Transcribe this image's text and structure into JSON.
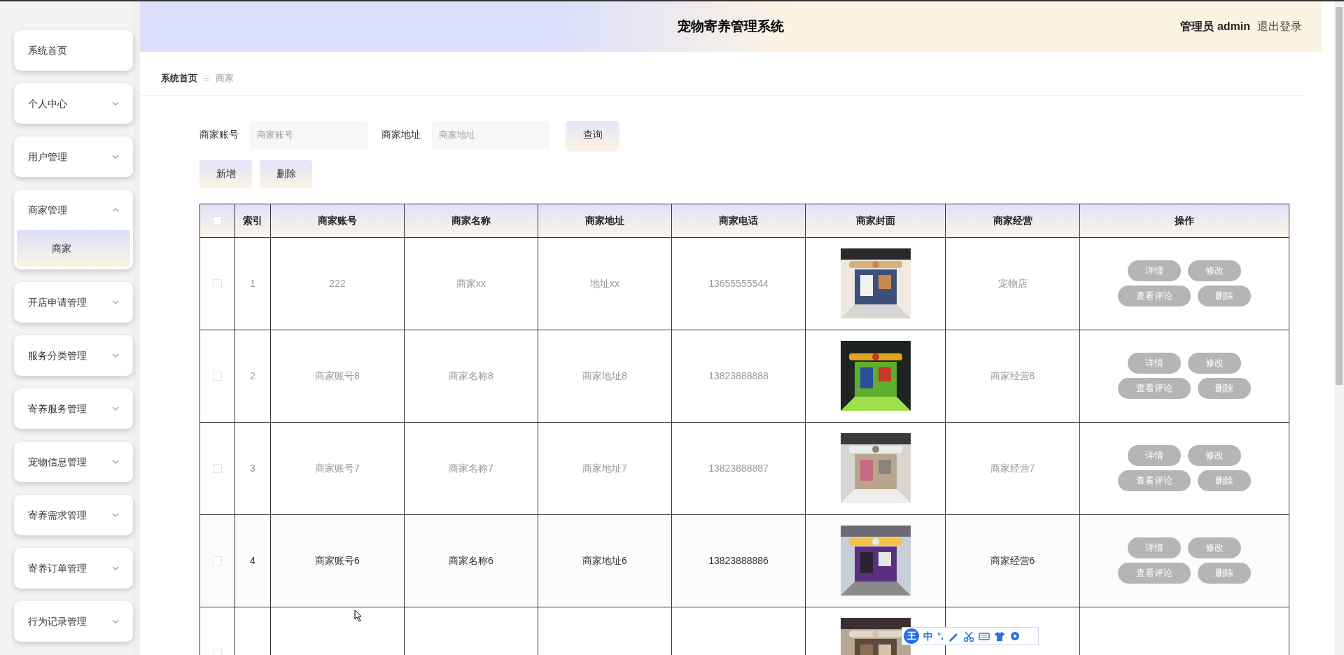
{
  "header": {
    "title": "宠物寄养管理系统",
    "user_role": "管理员",
    "user_name": "admin",
    "logout": "退出登录"
  },
  "sidebar": {
    "items": [
      {
        "label": "系统首页"
      },
      {
        "label": "个人中心",
        "expandable": true,
        "expanded": false
      },
      {
        "label": "用户管理",
        "expandable": true,
        "expanded": false
      },
      {
        "label": "商家管理",
        "expandable": true,
        "expanded": true,
        "children": [
          {
            "label": "商家",
            "selected": true
          }
        ]
      },
      {
        "label": "开店申请管理",
        "expandable": true,
        "expanded": false
      },
      {
        "label": "服务分类管理",
        "expandable": true,
        "expanded": false
      },
      {
        "label": "寄养服务管理",
        "expandable": true,
        "expanded": false
      },
      {
        "label": "宠物信息管理",
        "expandable": true,
        "expanded": false
      },
      {
        "label": "寄养需求管理",
        "expandable": true,
        "expanded": false
      },
      {
        "label": "寄养订单管理",
        "expandable": true,
        "expanded": false
      },
      {
        "label": "行为记录管理",
        "expandable": true,
        "expanded": false
      }
    ]
  },
  "breadcrumb": [
    {
      "label": "系统首页"
    },
    {
      "label": "商家"
    }
  ],
  "breadcrumb_separator": "☰",
  "search": {
    "fields": [
      {
        "label": "商家账号",
        "placeholder": "商家账号"
      },
      {
        "label": "商家地址",
        "placeholder": "商家地址"
      }
    ],
    "button": "查询"
  },
  "actions": [
    "新增",
    "删除"
  ],
  "table": {
    "all_checked": false,
    "columns": [
      "索引",
      "商家账号",
      "商家名称",
      "商家地址",
      "商家电话",
      "商家封面",
      "商家经营",
      "操作"
    ],
    "rows": [
      {
        "checked": false,
        "highlighted": false,
        "index": "1",
        "account": "222",
        "name": "商家xx",
        "address": "地址xx",
        "phone": "13655555544",
        "cover": {
          "kind": "picture"
        },
        "business": "宠物店",
        "buttons": [
          "详情",
          "修改",
          "查看评论",
          "删除"
        ]
      },
      {
        "checked": false,
        "highlighted": false,
        "index": "2",
        "account": "商家账号8",
        "name": "商家名称8",
        "address": "商家地址8",
        "phone": "13823888888",
        "cover": {
          "kind": "picture"
        },
        "business": "商家经营8",
        "buttons": [
          "详情",
          "修改",
          "查看评论",
          "删除"
        ]
      },
      {
        "checked": false,
        "highlighted": false,
        "index": "3",
        "account": "商家账号7",
        "name": "商家名称7",
        "address": "商家地址7",
        "phone": "13823888887",
        "cover": {
          "kind": "picture"
        },
        "business": "商家经营7",
        "buttons": [
          "详情",
          "修改",
          "查看评论",
          "删除"
        ]
      },
      {
        "checked": false,
        "highlighted": true,
        "index": "4",
        "account": "商家账号6",
        "name": "商家名称6",
        "address": "商家地址6",
        "phone": "13823888886",
        "cover": {
          "kind": "picture"
        },
        "business": "商家经营6",
        "buttons": [
          "详情",
          "修改",
          "查看评论",
          "删除"
        ]
      },
      {
        "checked": false,
        "cover": {
          "kind": "picture"
        }
      }
    ]
  },
  "ime_toolbar": {
    "logo": "王",
    "mode": "中",
    "punctuation": "°,"
  }
}
